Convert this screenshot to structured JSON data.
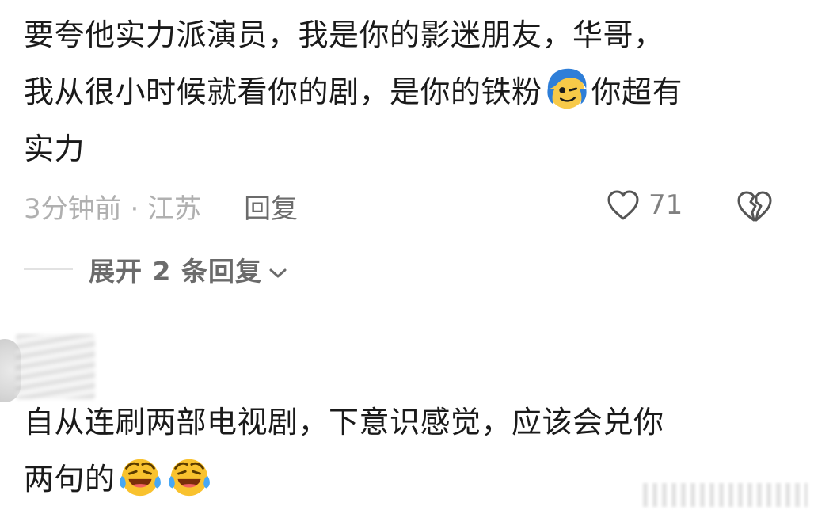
{
  "comment1": {
    "line1": "要夸他实力派演员，我是你的影迷朋友，华哥，",
    "line2a": "我从很小时候就看你的剧，是你的铁粉",
    "line2b": "你超有",
    "line3": "实力",
    "time_location": "3分钟前 · 江苏",
    "reply_label": "回复",
    "like_count": "71",
    "emoji": "blue-hair-cheeky-face-emoji"
  },
  "expand": {
    "label": "展开 2 条回复"
  },
  "comment2": {
    "line1": "自从连刷两部电视剧，下意识感觉，应该会兑你",
    "line2": "两句的",
    "emoji": "laughing-crying-face-emoji"
  },
  "colors": {
    "text": "#1a1a1a",
    "meta": "#a6a6a6",
    "action": "#6b6b6b"
  }
}
